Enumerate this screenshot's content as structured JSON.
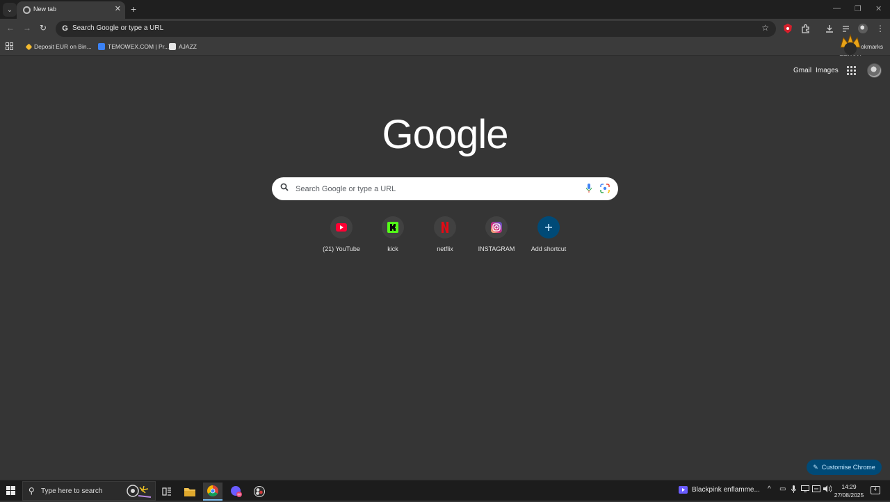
{
  "browser": {
    "tab": {
      "title": "New tab"
    },
    "omnibox": {
      "text": "Search Google or type a URL"
    },
    "bookmarks": [
      {
        "label": "Deposit EUR on Bin...",
        "icon": "binance-icon",
        "color": "#f3ba2f"
      },
      {
        "label": "TEMOWEX.COM | Pr...",
        "icon": "temowex-icon",
        "color": "#3b82f6"
      },
      {
        "label": "AJAZZ",
        "icon": "ajazz-icon",
        "color": "#e6e6e6"
      }
    ],
    "bookmarks_overflow": "Bookmarks",
    "all_bookmarks_visible": "okmarks"
  },
  "page": {
    "links": {
      "gmail": "Gmail",
      "images": "Images"
    },
    "logo": "Google",
    "search": {
      "placeholder": "Search Google or type a URL"
    },
    "shortcuts": [
      {
        "label": "(21) YouTube",
        "icon": "youtube-icon",
        "color": "#ff0033"
      },
      {
        "label": "kick",
        "icon": "kick-icon",
        "color": "#53fc18"
      },
      {
        "label": "netflix",
        "icon": "netflix-icon",
        "color": "#e50914"
      },
      {
        "label": "INSTAGRAM",
        "icon": "instagram-icon",
        "color": "#d62976"
      },
      {
        "label": "Add shortcut",
        "icon": "plus-icon",
        "color": "#004a77"
      }
    ],
    "customise": "Customise Chrome",
    "profile_badge": "ZENON"
  },
  "taskbar": {
    "search_placeholder": "Type here to search",
    "media": "Blackpink enflamme...",
    "time": "14:29",
    "date": "27/08/2025",
    "notifications": "4"
  }
}
